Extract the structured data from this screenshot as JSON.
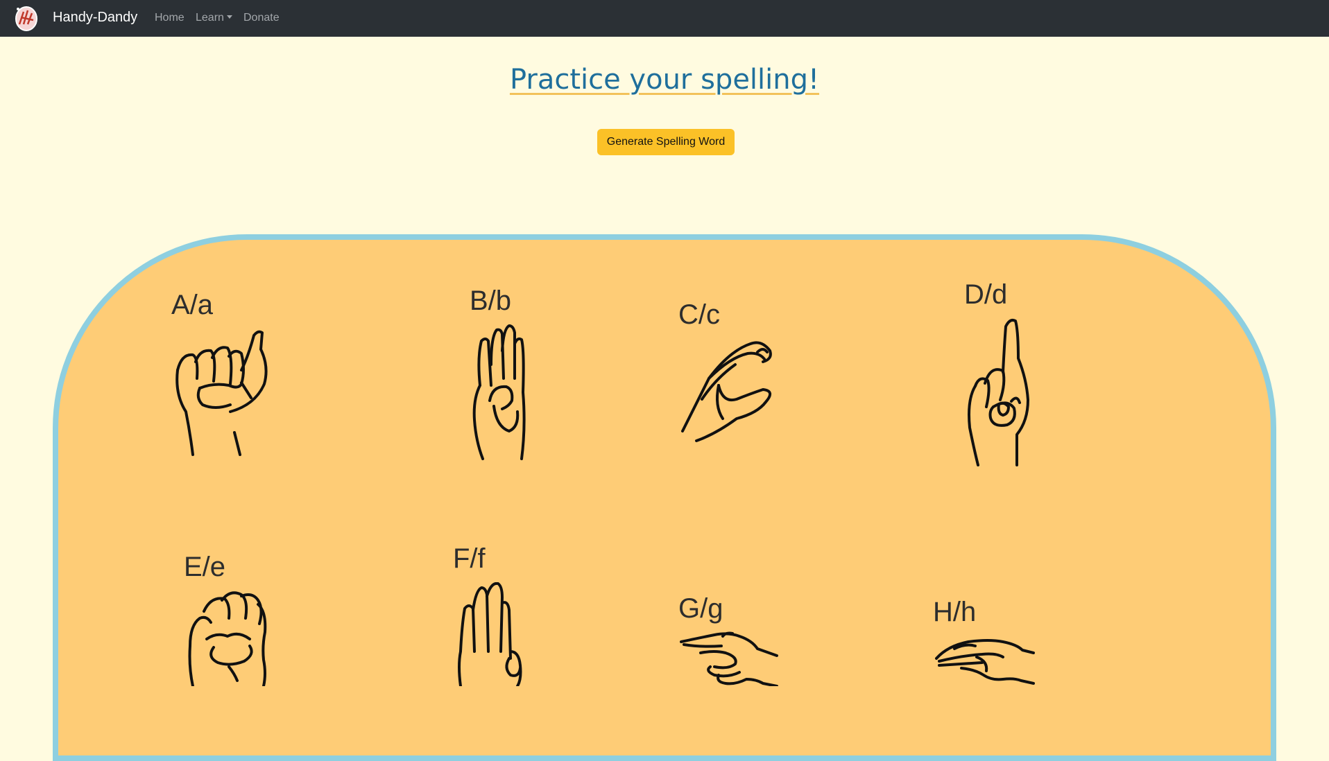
{
  "navbar": {
    "brand": "Handy-Dandy",
    "logo_icon": "hands-logo-icon",
    "links": [
      {
        "label": "Home"
      },
      {
        "label": "Learn",
        "dropdown": true
      },
      {
        "label": "Donate"
      }
    ]
  },
  "main": {
    "title": "Practice your spelling!",
    "generate_button": "Generate Spelling Word"
  },
  "alphabet": [
    {
      "label": "A/a",
      "icon": "asl-a-hand-icon"
    },
    {
      "label": "B/b",
      "icon": "asl-b-hand-icon"
    },
    {
      "label": "C/c",
      "icon": "asl-c-hand-icon"
    },
    {
      "label": "D/d",
      "icon": "asl-d-hand-icon"
    },
    {
      "label": "E/e",
      "icon": "asl-e-hand-icon"
    },
    {
      "label": "F/f",
      "icon": "asl-f-hand-icon"
    },
    {
      "label": "G/g",
      "icon": "asl-g-hand-icon"
    },
    {
      "label": "H/h",
      "icon": "asl-h-hand-icon"
    }
  ],
  "colors": {
    "page_background": "#fffbe0",
    "navbar": "#2b3035",
    "title": "#1f6f9c",
    "button": "#fbc127",
    "board_fill": "#fecc76",
    "board_border": "#8ecfe0"
  }
}
